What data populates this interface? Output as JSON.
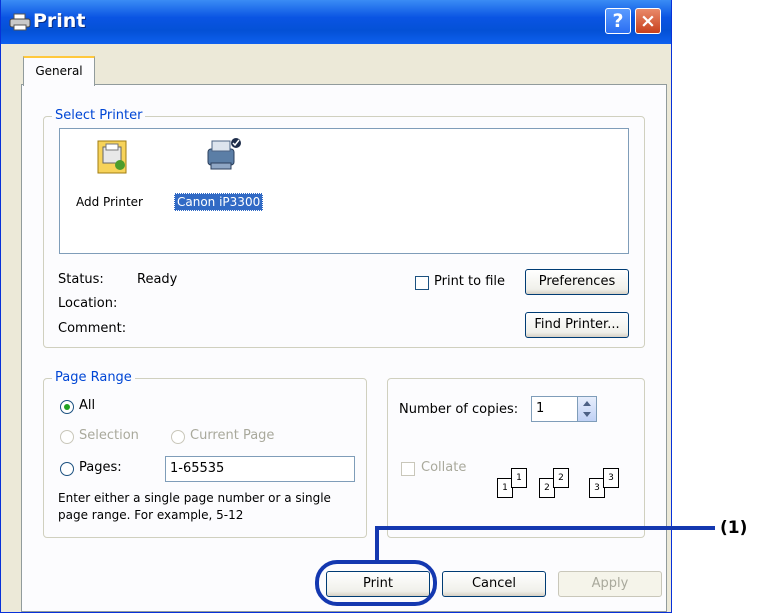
{
  "window": {
    "title": "Print",
    "help_label": "?",
    "close_label": "×"
  },
  "tab": {
    "label": "General"
  },
  "select_printer": {
    "legend": "Select Printer",
    "items": [
      {
        "label": "Add Printer",
        "icon": "add-printer-icon"
      },
      {
        "label": "Canon iP3300",
        "icon": "printer-icon",
        "selected": true
      }
    ],
    "status_label": "Status:",
    "status_value": "Ready",
    "location_label": "Location:",
    "comment_label": "Comment:",
    "print_to_file_label": "Print to file",
    "print_to_file_checked": false,
    "preferences_button": "Preferences",
    "find_printer_button": "Find Printer..."
  },
  "page_range": {
    "legend": "Page Range",
    "all_label": "All",
    "selection_label": "Selection",
    "current_page_label": "Current Page",
    "pages_label": "Pages:",
    "pages_value": "1-65535",
    "help_text_1": "Enter either a single page number or a single",
    "help_text_2": "page range.  For example, 5-12",
    "selected": "All"
  },
  "copies": {
    "label": "Number of copies:",
    "value": "1",
    "collate_label": "Collate",
    "collate_checked": false
  },
  "buttons": {
    "print": "Print",
    "cancel": "Cancel",
    "apply": "Apply"
  },
  "callout": {
    "label": "(1)"
  },
  "colors": {
    "titlebar": "#0a54e3",
    "accent": "#0046d5",
    "callout": "#1438b0"
  }
}
